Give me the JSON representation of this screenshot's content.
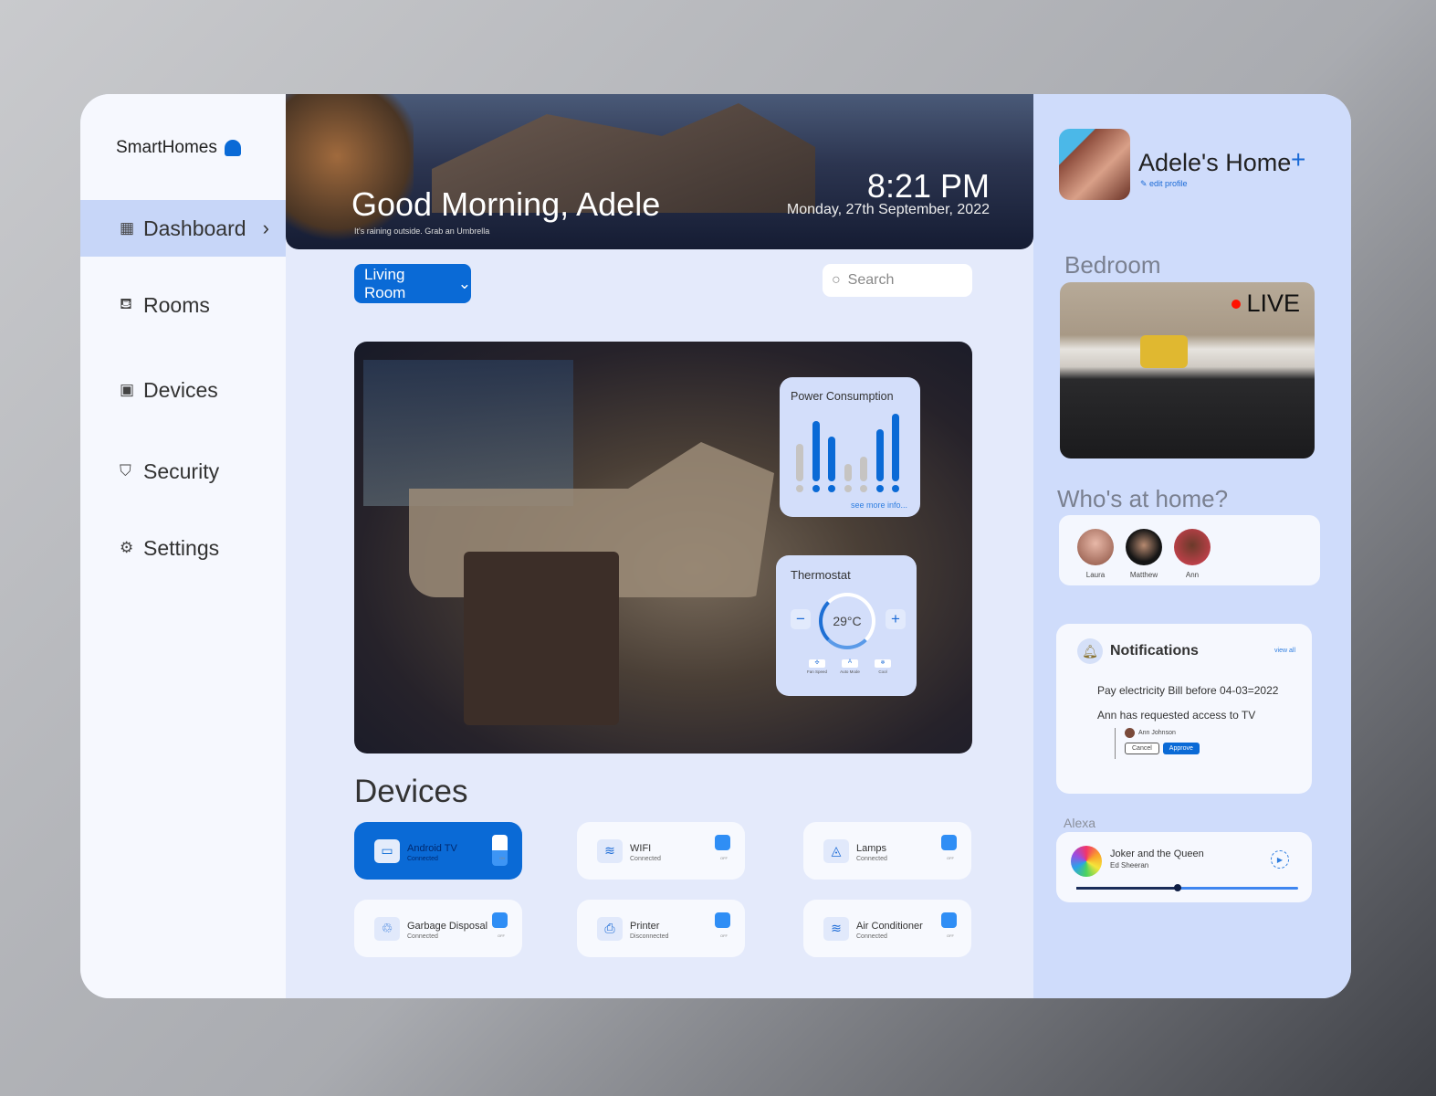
{
  "brand": "SmartHomes",
  "nav": [
    {
      "label": "Dashboard",
      "icon": "grid-icon"
    },
    {
      "label": "Rooms",
      "icon": "sofa-icon"
    },
    {
      "label": "Devices",
      "icon": "devices-icon"
    },
    {
      "label": "Security",
      "icon": "shield-icon"
    },
    {
      "label": "Settings",
      "icon": "gear-icon"
    }
  ],
  "hero": {
    "greeting": "Good Morning, Adele",
    "subtitle": "It's raining outside. Grab an Umbrella",
    "time": "8:21 PM",
    "date": "Monday, 27th September, 2022"
  },
  "room_select": "Living Room",
  "search_placeholder": "Search",
  "power": {
    "title": "Power Consumption",
    "link": "see more info...",
    "values": [
      0.5,
      0.8,
      0.6,
      0.23,
      0.33,
      0.7,
      0.9
    ],
    "highlight": [
      false,
      true,
      true,
      false,
      false,
      true,
      true
    ]
  },
  "thermostat": {
    "title": "Thermostat",
    "temp": "29°C",
    "minus": "−",
    "plus": "+",
    "modes": [
      {
        "label": "Fan Speed",
        "icon": "fan-icon"
      },
      {
        "label": "Auto Mode",
        "icon": "auto-icon"
      },
      {
        "label": "Cool",
        "icon": "snowflake-icon"
      }
    ]
  },
  "devices_title": "Devices",
  "devices": [
    {
      "name": "Android TV",
      "status": "Connected",
      "on": true,
      "icon": "▭",
      "toggle": "ON"
    },
    {
      "name": "WIFI",
      "status": "Connected",
      "on": false,
      "icon": "≋",
      "toggle": "OFF"
    },
    {
      "name": "Lamps",
      "status": "Connected",
      "on": false,
      "icon": "◬",
      "toggle": "OFF"
    },
    {
      "name": "Garbage Disposal",
      "status": "Connected",
      "on": false,
      "icon": "♲",
      "toggle": "OFF"
    },
    {
      "name": "Printer",
      "status": "Disconnected",
      "on": false,
      "icon": "⎙",
      "toggle": "OFF"
    },
    {
      "name": "Air Conditioner",
      "status": "Connected",
      "on": false,
      "icon": "≋",
      "toggle": "OFF"
    }
  ],
  "profile": {
    "home": "Adele's Home",
    "edit": "✎ edit profile",
    "add": "+"
  },
  "camera": {
    "label": "Bedroom",
    "live": "LIVE"
  },
  "who": {
    "title": "Who's at home?",
    "people": [
      "Laura",
      "Matthew",
      "Ann"
    ]
  },
  "notifications": {
    "title": "Notifications",
    "view_all": "view all",
    "items": [
      "Pay electricity Bill before 04-03=2022",
      "Ann has requested access to TV"
    ],
    "requester": "Ann Johnson",
    "cancel": "Cancel",
    "approve": "Approve"
  },
  "alexa": {
    "label": "Alexa",
    "song": "Joker and the Queen",
    "artist": "Ed Sheeran",
    "progress": 0.45
  },
  "colors": {
    "accent": "#0a6ad6",
    "sidebar": "#f6f8fe",
    "main": "#e4eafb",
    "right": "#cfdcfb"
  }
}
